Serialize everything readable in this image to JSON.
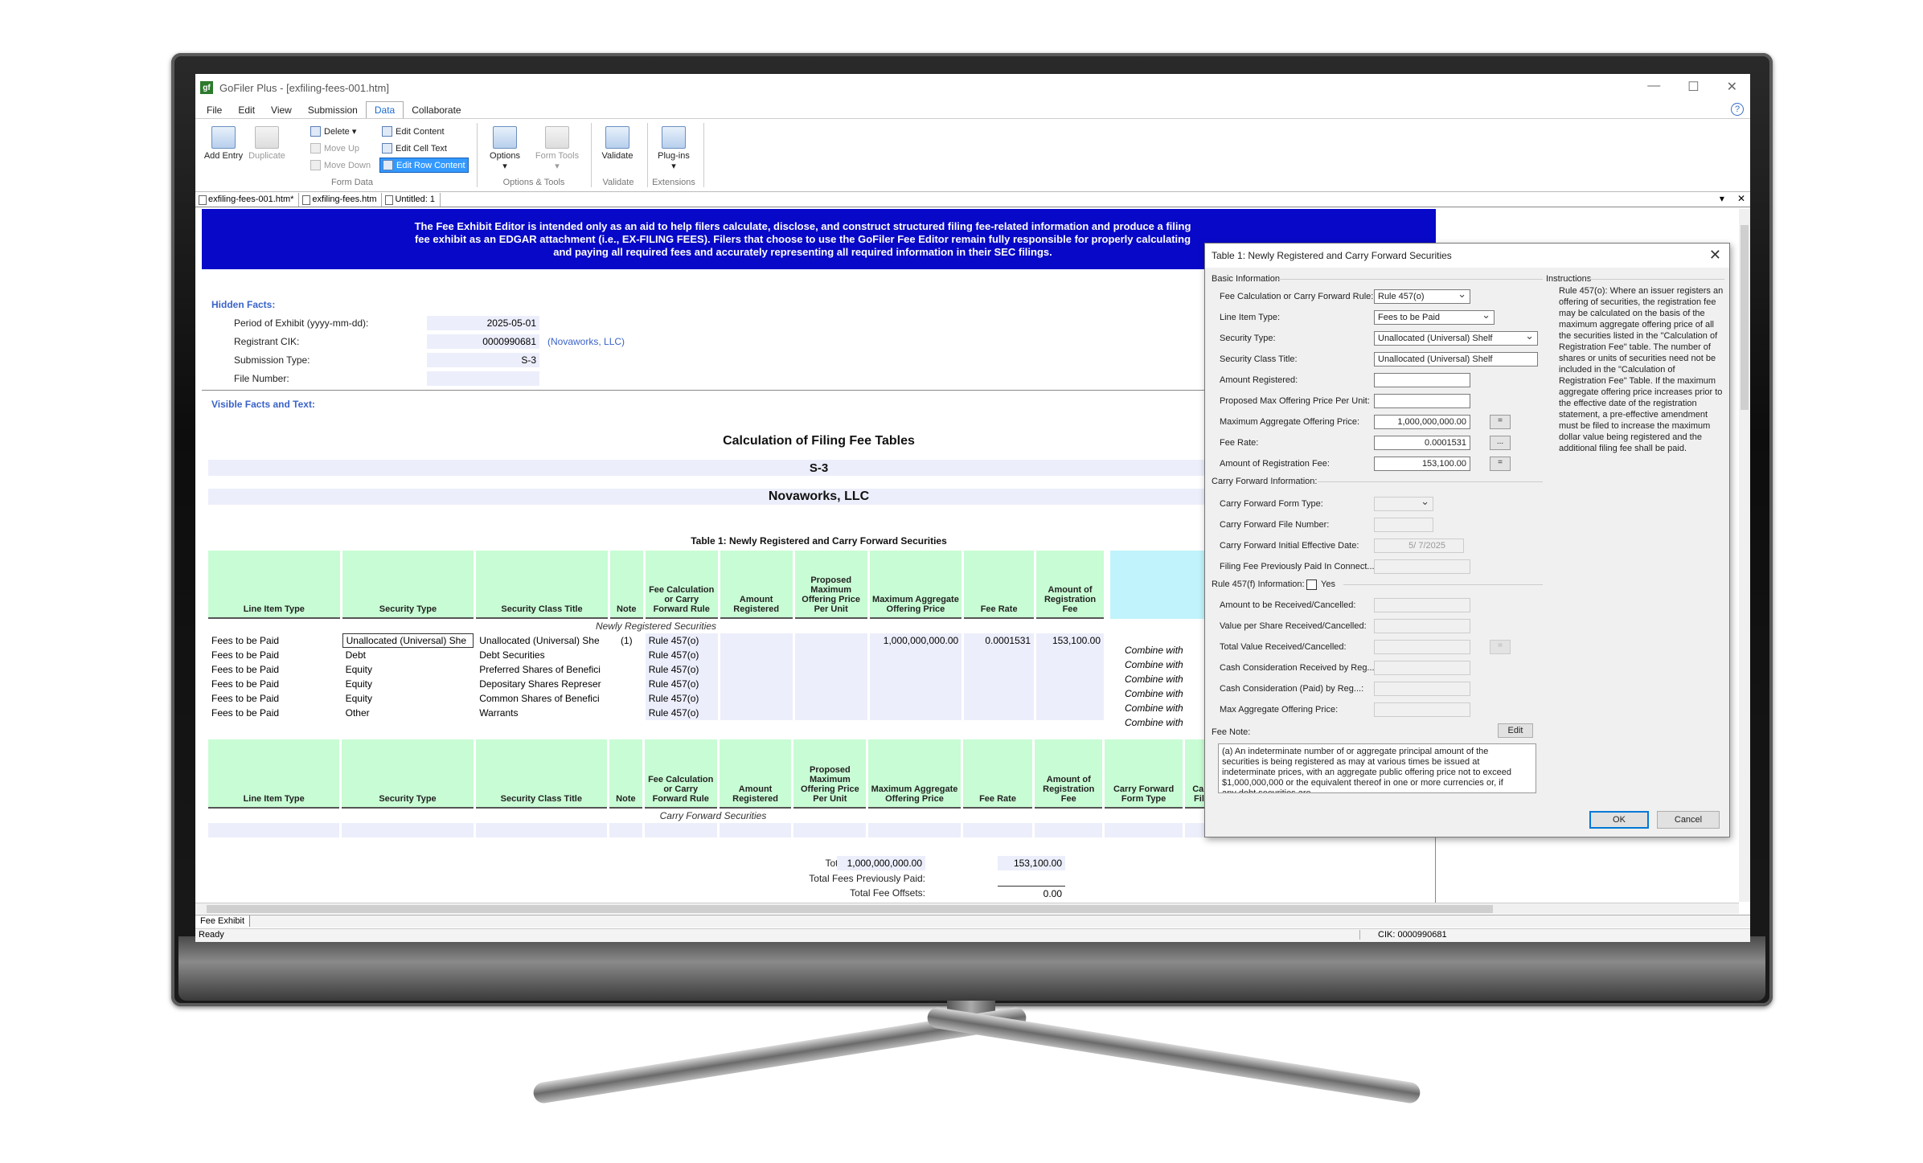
{
  "window": {
    "title": "GoFiler Plus - [exfiling-fees-001.htm]",
    "logo": "gf"
  },
  "menu": [
    "File",
    "Edit",
    "View",
    "Submission",
    "Data",
    "Collaborate"
  ],
  "ribbon": {
    "add_entry": "Add Entry",
    "duplicate": "Duplicate",
    "delete": "Delete",
    "move_up": "Move Up",
    "move_down": "Move Down",
    "edit_content": "Edit Content",
    "edit_cell_text": "Edit Cell Text",
    "edit_row_content": "Edit Row Content",
    "options": "Options",
    "form_tools": "Form Tools",
    "validate": "Validate",
    "plugins": "Plug-ins",
    "group_form_data": "Form Data",
    "group_options_tools": "Options & Tools",
    "group_validate": "Validate",
    "group_extensions": "Extensions"
  },
  "tabs": [
    "exfiling-fees-001.htm*",
    "exfiling-fees.htm",
    "Untitled: 1"
  ],
  "banner": "The Fee Exhibit Editor is intended only as an aid to help filers calculate, disclose, and construct structured filing fee-related information and produce a filing fee exhibit as an EDGAR attachment (i.e., EX-FILING FEES). Filers that choose to use the GoFiler Fee Editor remain fully responsible for properly calculating and paying all required fees and accurately representing all required information in their SEC filings.",
  "hidden": {
    "title": "Hidden Facts:",
    "period_label": "Period of Exhibit (yyyy-mm-dd):",
    "period": "2025-05-01",
    "cik_label": "Registrant CIK:",
    "cik": "0000990681",
    "cik_name": "(Novaworks, LLC)",
    "sub_label": "Submission Type:",
    "sub": "S-3",
    "file_label": "File Number:",
    "file": ""
  },
  "visible_title": "Visible Facts and Text:",
  "calc_title": "Calculation of Filing Fee Tables",
  "form_type": "S-3",
  "company": "Novaworks, LLC",
  "table1_title": "Table 1: Newly Registered and Carry Forward Securities",
  "headers": [
    "Line Item Type",
    "Security Type",
    "Security Class Title",
    "Note",
    "Fee Calculation or Carry Forward Rule",
    "Amount Registered",
    "Proposed Maximum Offering Price Per Unit",
    "Maximum Aggregate Offering Price",
    "Fee Rate",
    "Amount of Registration Fee"
  ],
  "headers2": [
    "Line Item Type",
    "Security Type",
    "Security Class Title",
    "Note",
    "Fee Calculation or Carry Forward Rule",
    "Amount Registered",
    "Proposed Maximum Offering Price Per Unit",
    "Maximum Aggregate Offering Price",
    "Fee Rate",
    "Amount of Registration Fee",
    "Carry Forward Form Type",
    "Carr File"
  ],
  "newly_label": "Newly Registered Securities",
  "carry_label": "Carry Forward Securities",
  "rows": [
    {
      "type": "Fees to be Paid",
      "sec": "Unallocated (Universal) She",
      "cls": "Unallocated (Universal) She",
      "note": "(1)",
      "rule": "Rule 457(o)",
      "amt": "",
      "price": "",
      "max": "1,000,000,000.00",
      "rate": "0.0001531",
      "fee": "153,100.00",
      "combine": "Combine with"
    },
    {
      "type": "Fees to be Paid",
      "sec": "Debt",
      "cls": "Debt Securities",
      "note": "",
      "rule": "Rule 457(o)",
      "amt": "",
      "price": "",
      "max": "",
      "rate": "",
      "fee": "",
      "combine": "Combine with"
    },
    {
      "type": "Fees to be Paid",
      "sec": "Equity",
      "cls": "Preferred Shares of Benefici",
      "note": "",
      "rule": "Rule 457(o)",
      "amt": "",
      "price": "",
      "max": "",
      "rate": "",
      "fee": "",
      "combine": "Combine with"
    },
    {
      "type": "Fees to be Paid",
      "sec": "Equity",
      "cls": "Depositary Shares Represer",
      "note": "",
      "rule": "Rule 457(o)",
      "amt": "",
      "price": "",
      "max": "",
      "rate": "",
      "fee": "",
      "combine": "Combine with"
    },
    {
      "type": "Fees to be Paid",
      "sec": "Equity",
      "cls": "Common Shares of Benefici",
      "note": "",
      "rule": "Rule 457(o)",
      "amt": "",
      "price": "",
      "max": "",
      "rate": "",
      "fee": "",
      "combine": "Combine with"
    },
    {
      "type": "Fees to be Paid",
      "sec": "Other",
      "cls": "Warrants",
      "note": "",
      "rule": "Rule 457(o)",
      "amt": "",
      "price": "",
      "max": "",
      "rate": "",
      "fee": "",
      "combine": "Combine with"
    }
  ],
  "totals": {
    "offering_label": "Total Offering Amounts:",
    "offering": "1,000,000,000.00",
    "offering_fee": "153,100.00",
    "prev_label": "Total Fees Previously Paid:",
    "offsets_label": "Total Fee Offsets:",
    "offsets": "0.00"
  },
  "sheet_tab": "Fee Exhibit",
  "status": "Ready",
  "status_cik": "CIK: 0000990681",
  "dialog": {
    "title": "Table 1: Newly Registered and Carry Forward Securities",
    "basic": "Basic Information",
    "instructions_label": "Instructions",
    "fee_rule_label": "Fee Calculation or Carry Forward Rule:",
    "fee_rule": "Rule 457(o)",
    "line_type_label": "Line Item Type:",
    "line_type": "Fees to be Paid",
    "sec_type_label": "Security Type:",
    "sec_type": "Unallocated (Universal) Shelf",
    "sec_title_label": "Security Class Title:",
    "sec_title": "Unallocated (Universal) Shelf",
    "amt_label": "Amount Registered:",
    "amt": "",
    "ppu_label": "Proposed Max Offering Price Per Unit:",
    "ppu": "",
    "max_label": "Maximum Aggregate Offering Price:",
    "max": "1,000,000,000.00",
    "rate_label": "Fee Rate:",
    "rate": "0.0001531",
    "fee_label": "Amount of Registration Fee:",
    "fee": "153,100.00",
    "cf_label": "Carry Forward Information:",
    "cf_form_label": "Carry Forward Form Type:",
    "cf_file_label": "Carry Forward File Number:",
    "cf_date_label": "Carry Forward Initial Effective Date:",
    "cf_date": "5/ 7/2025",
    "cf_prev_label": "Filing Fee Previously Paid In Connect...:",
    "r457_label": "Rule 457(f) Information:",
    "yes": "Yes",
    "recv_label": "Amount to be Received/Cancelled:",
    "vps_label": "Value per Share Received/Cancelled:",
    "tv_label": "Total Value Received/Cancelled:",
    "ccr_label": "Cash Consideration Received by Reg...:",
    "ccp_label": "Cash Consideration (Paid) by Reg...:",
    "mao_label": "Max Aggregate Offering Price:",
    "fee_note_label": "Fee Note:",
    "edit": "Edit",
    "fee_note": "(a) An indeterminate number of or aggregate principal amount of the securities is being registered as may at various times be issued at indeterminate prices, with an aggregate public offering price not to exceed $1,000,000,000 or the equivalent thereof in one or more currencies or, if any debt securities are",
    "instructions": "Rule 457(o): Where an issuer registers an offering of securities, the registration fee may be calculated on the basis of the maximum aggregate offering price of all the securities listed in the \"Calculation of Registration Fee\" table. The number of shares or units of securities need not be included in the \"Calculation of Registration Fee\" Table. If the maximum aggregate offering price increases prior to the effective date of the registration statement, a pre-effective amendment must be filed to increase the maximum dollar value being registered and the additional filing fee shall be paid.",
    "ok": "OK",
    "cancel": "Cancel",
    "eq": "=",
    "dots": "..."
  }
}
